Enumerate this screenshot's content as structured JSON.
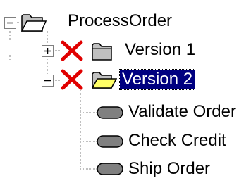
{
  "tree": {
    "root": {
      "label": "ProcessOrder",
      "expanded": true,
      "icon": "open-folder-icon"
    },
    "versions": [
      {
        "label": "Version 1",
        "expanded": false,
        "selected": false,
        "status_icon": "red-x-icon",
        "icon": "closed-folder-icon"
      },
      {
        "label": "Version 2",
        "expanded": true,
        "selected": true,
        "status_icon": "red-x-icon",
        "icon": "open-folder-icon",
        "children": [
          {
            "label": "Validate Order",
            "icon": "activity-pill-icon"
          },
          {
            "label": "Check Credit",
            "icon": "activity-pill-icon"
          },
          {
            "label": "Ship Order",
            "icon": "activity-pill-icon"
          }
        ]
      }
    ]
  },
  "colors": {
    "selection_bg": "#000080",
    "selection_fg": "#ffffff",
    "red_x": "#e00000",
    "folder_open_yellow": "#ffff66",
    "pill_fill": "#808080"
  }
}
